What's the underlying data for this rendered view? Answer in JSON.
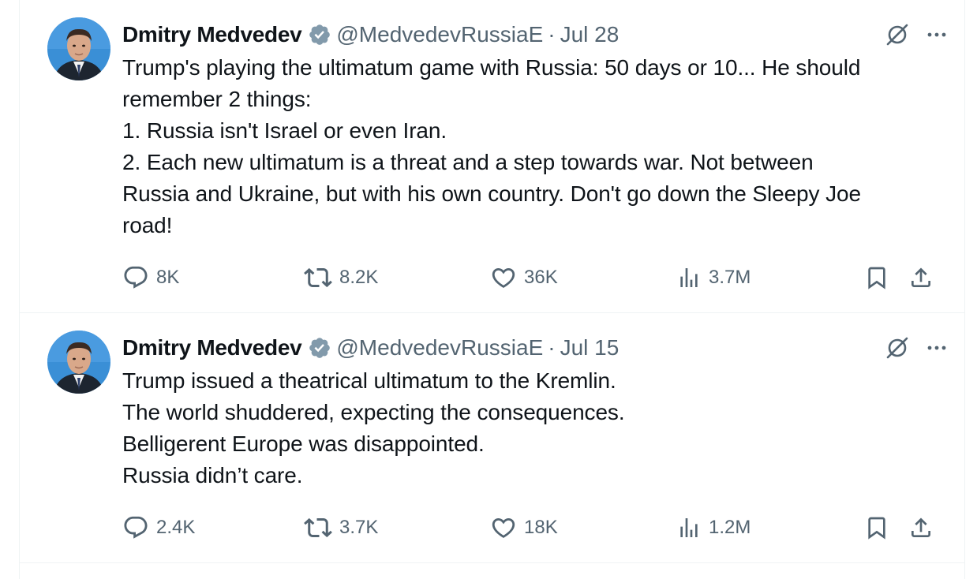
{
  "tweets": [
    {
      "author": {
        "name": "Dmitry Medvedev",
        "handle": "@MedvedevRussiaE",
        "verified": true
      },
      "separator": "·",
      "date": "Jul 28",
      "lines": [
        "Trump's playing the ultimatum game with Russia: 50 days or 10... He should",
        "remember 2 things:",
        "1. Russia isn't Israel or even Iran.",
        "2. Each new ultimatum is a threat and a step towards war. Not between",
        "Russia and Ukraine, but with his own country. Don't go down the Sleepy Joe",
        "road!"
      ],
      "stats": {
        "replies": "8K",
        "reposts": "8.2K",
        "likes": "36K",
        "views": "3.7M"
      }
    },
    {
      "author": {
        "name": "Dmitry Medvedev",
        "handle": "@MedvedevRussiaE",
        "verified": true
      },
      "separator": "·",
      "date": "Jul 15",
      "lines": [
        "Trump issued a theatrical ultimatum to the Kremlin.",
        "The world shuddered, expecting the consequences.",
        "Belligerent Europe was disappointed.",
        "Russia didn’t care."
      ],
      "stats": {
        "replies": "2.4K",
        "reposts": "3.7K",
        "likes": "18K",
        "views": "1.2M"
      }
    }
  ],
  "icons": {
    "verified": "verified-badge-icon",
    "grok": "grok-icon",
    "more": "more-options-icon",
    "reply": "reply-icon",
    "repost": "repost-icon",
    "like": "heart-icon",
    "views": "views-chart-icon",
    "bookmark": "bookmark-icon",
    "share": "share-icon"
  },
  "colors": {
    "text": "#0f1419",
    "secondary": "#536471",
    "border": "#eff3f4",
    "avatar_bg": "#3a8fd6"
  }
}
